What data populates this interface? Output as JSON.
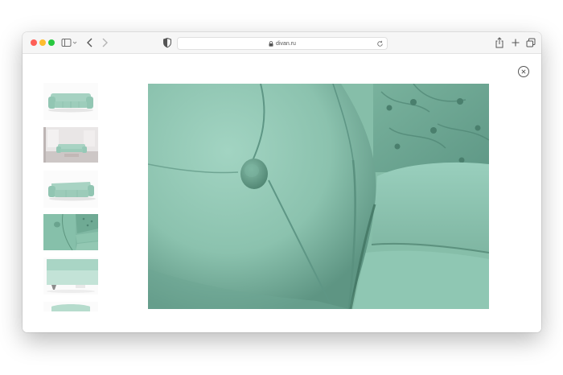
{
  "browser": {
    "url": "divan.ru",
    "buttons": {
      "sidebar": "sidebar-icon",
      "back": "chevron-left-icon",
      "forward": "chevron-right-icon",
      "privacy": "shield-icon",
      "reload": "reload-icon",
      "share": "share-icon",
      "new_tab": "plus-icon",
      "tab_overview": "tabs-icon"
    }
  },
  "gallery": {
    "close_icon": "close-icon",
    "thumbnail_count": 6,
    "active_thumbnail": 4,
    "image_description_colors": {
      "velvet": "#8ec7b3",
      "velvet_shadow": "#5f9583",
      "background": "#ffffff"
    }
  }
}
